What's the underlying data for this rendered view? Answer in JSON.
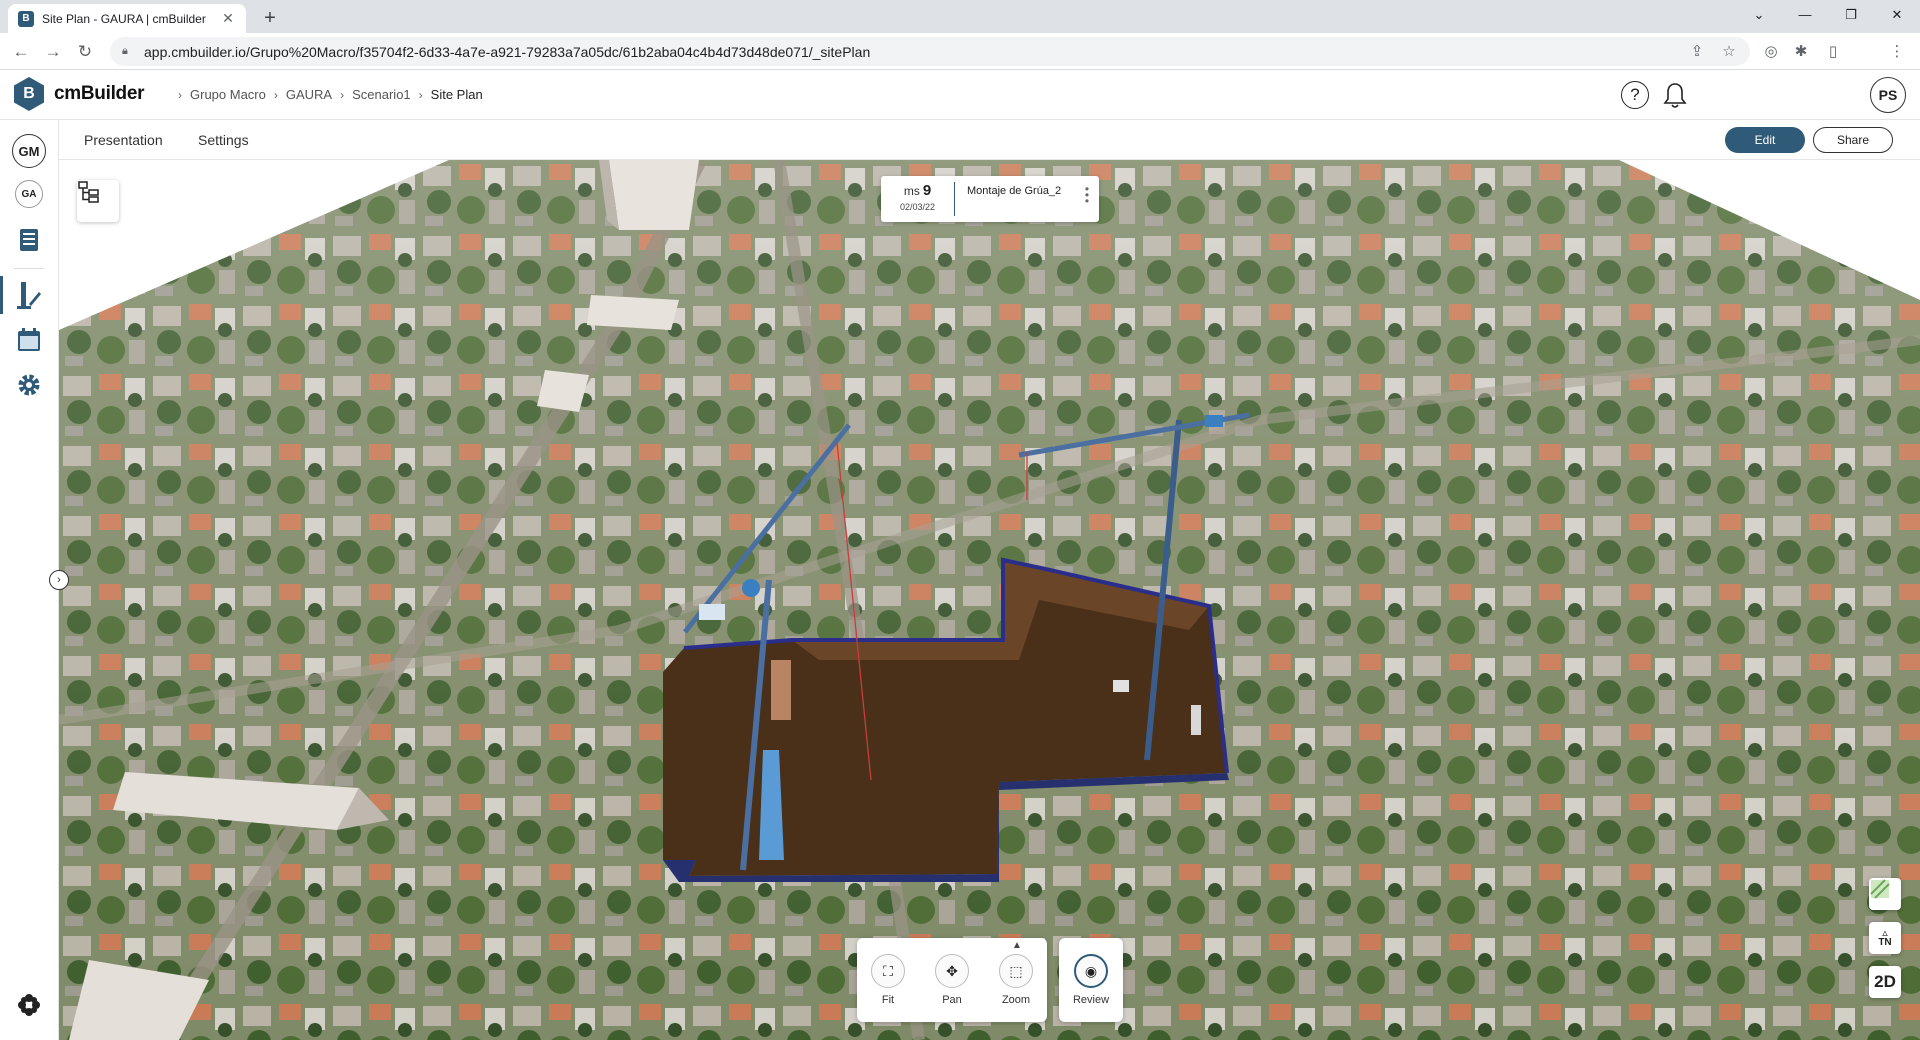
{
  "browser": {
    "tab_title": "Site Plan - GAURA | cmBuilder",
    "favicon_letter": "B",
    "url": "app.cmbuilder.io/Grupo%20Macro/f35704f2-6d33-4a7e-a921-79283a7a05dc/61b2aba04c4b4d73d48de071/_sitePlan"
  },
  "app": {
    "logo_letter": "B",
    "logo_text": "cmBuilder",
    "breadcrumb": [
      "Grupo Macro",
      "GAURA",
      "Scenario1",
      "Site Plan"
    ],
    "user_initials": "PS"
  },
  "rail": {
    "org_avatar": "GM",
    "project_avatar": "GA"
  },
  "subbar": {
    "tabs": [
      "Presentation",
      "Settings"
    ],
    "edit_label": "Edit",
    "share_label": "Share"
  },
  "milestone": {
    "prefix": "ms",
    "number": "9",
    "date": "02/03/22",
    "name": "Montaje de Grúa_2"
  },
  "tools": {
    "fit": "Fit",
    "pan": "Pan",
    "zoom": "Zoom",
    "review": "Review"
  },
  "side_controls": {
    "north": "TN",
    "view_mode": "2D"
  },
  "colors": {
    "accent": "#2f5a78",
    "excavation": "#5a3a22",
    "crane": "#3a7fc0"
  }
}
